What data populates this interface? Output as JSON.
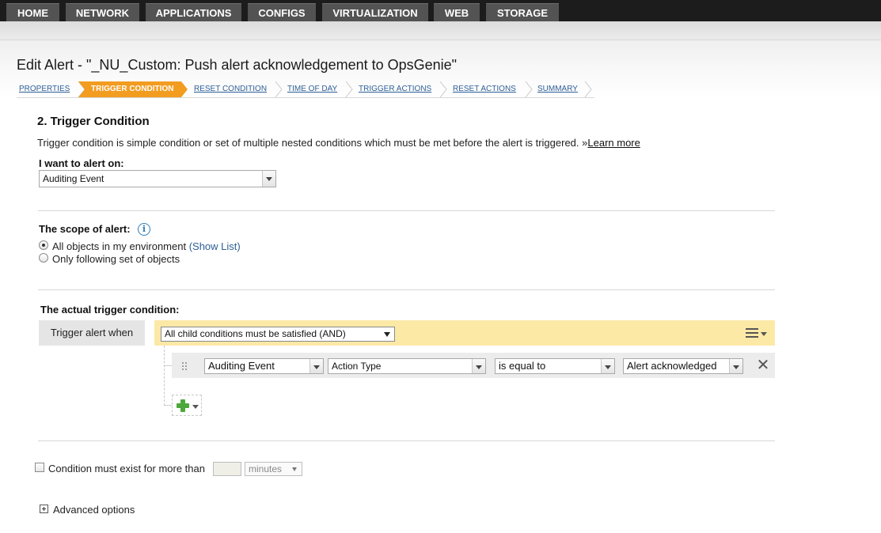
{
  "nav": {
    "tabs": [
      {
        "label": "HOME"
      },
      {
        "label": "NETWORK"
      },
      {
        "label": "APPLICATIONS"
      },
      {
        "label": "CONFIGS"
      },
      {
        "label": "VIRTUALIZATION"
      },
      {
        "label": "WEB"
      },
      {
        "label": "STORAGE"
      }
    ]
  },
  "page": {
    "title": "Edit Alert - \"_NU_Custom: Push alert acknowledgement to OpsGenie\""
  },
  "wizard": {
    "steps": [
      {
        "label": "PROPERTIES"
      },
      {
        "label": "TRIGGER CONDITION",
        "active": true
      },
      {
        "label": "RESET CONDITION"
      },
      {
        "label": "TIME OF DAY"
      },
      {
        "label": "TRIGGER ACTIONS"
      },
      {
        "label": "RESET ACTIONS"
      },
      {
        "label": "SUMMARY"
      }
    ],
    "active_color": "#f29c20"
  },
  "section": {
    "title": "2. Trigger Condition",
    "description": "Trigger condition is simple condition or set of multiple nested conditions which must be met before the alert is triggered.",
    "learn_more_prefix": "»",
    "learn_more": "Learn more"
  },
  "alert_on": {
    "label": "I want to alert on:",
    "value": "Auditing Event"
  },
  "scope": {
    "label": "The scope of alert:",
    "info_icon": "info-icon",
    "option_all": "All objects in my environment",
    "show_list": "(Show List)",
    "option_some": "Only following set of objects",
    "selected": "all"
  },
  "trigger": {
    "label": "The actual trigger condition:",
    "when_label": "Trigger alert when",
    "group_mode": "All child conditions must be satisfied (AND)",
    "highlight_color": "#fce9a6",
    "condition": {
      "object": "Auditing Event",
      "field": "Action Type",
      "operator": "is equal to",
      "value": "Alert acknowledged"
    }
  },
  "duration": {
    "label": "Condition must exist for more than",
    "value": "",
    "unit": "minutes"
  },
  "advanced": {
    "label": "Advanced options"
  }
}
